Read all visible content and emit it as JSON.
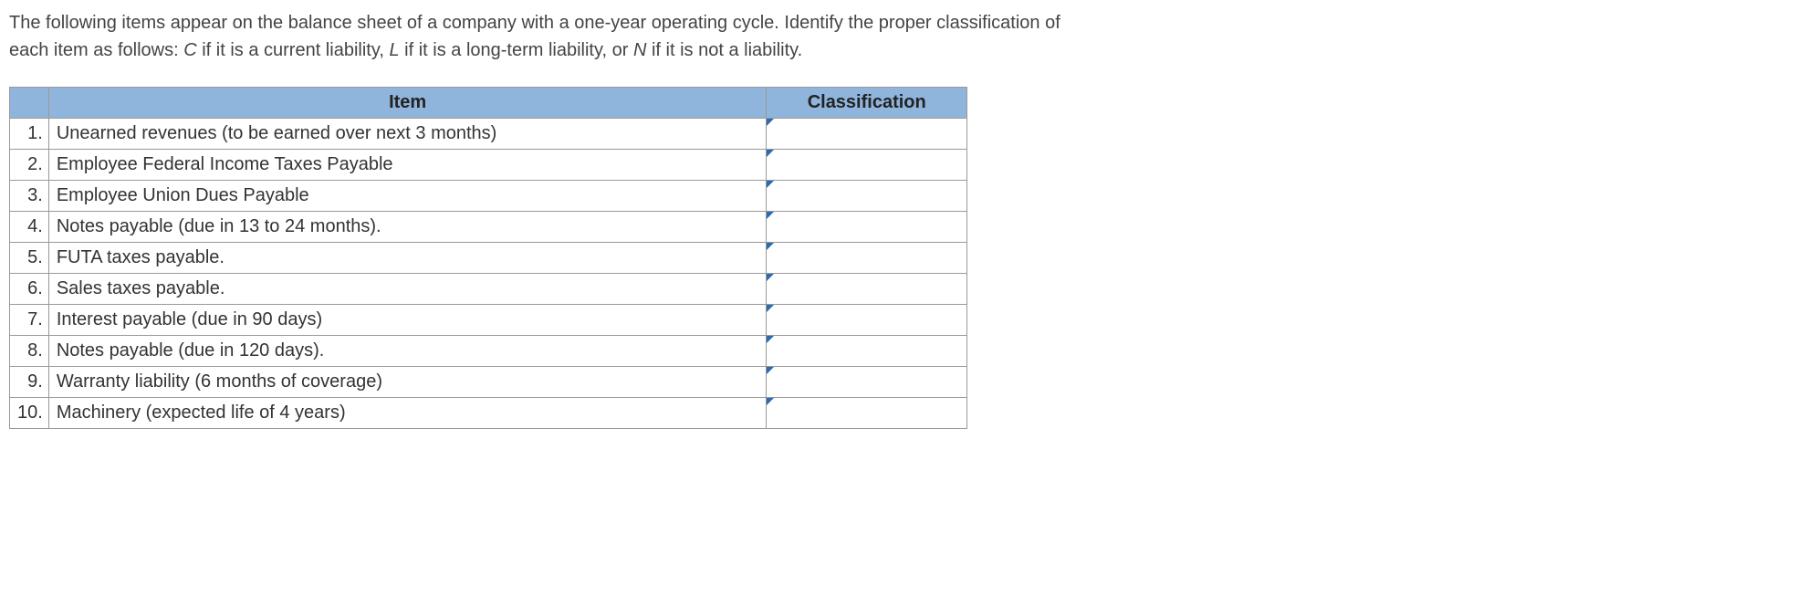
{
  "instructions": {
    "line1_pre": "The following items appear on the balance sheet of a company with a one-year operating cycle. Identify the proper classification of",
    "line2_pre": "each item as follows: ",
    "c_letter": "C",
    "c_suffix": " if it is a current liability, ",
    "l_letter": "L",
    "l_suffix": " if it is a long-term liability, or ",
    "n_letter": "N",
    "n_suffix": " if it is not a liability."
  },
  "headers": {
    "item": "Item",
    "classification": "Classification"
  },
  "rows": [
    {
      "num": "1.",
      "item": "Unearned revenues (to be earned over next 3 months)",
      "classification": ""
    },
    {
      "num": "2.",
      "item": "Employee Federal Income Taxes Payable",
      "classification": ""
    },
    {
      "num": "3.",
      "item": "Employee Union Dues Payable",
      "classification": ""
    },
    {
      "num": "4.",
      "item": "Notes payable (due in 13 to 24 months).",
      "classification": ""
    },
    {
      "num": "5.",
      "item": "FUTA taxes payable.",
      "classification": ""
    },
    {
      "num": "6.",
      "item": "Sales taxes payable.",
      "classification": ""
    },
    {
      "num": "7.",
      "item": "Interest payable (due in 90 days)",
      "classification": ""
    },
    {
      "num": "8.",
      "item": "Notes payable (due in 120 days).",
      "classification": ""
    },
    {
      "num": "9.",
      "item": "Warranty liability (6 months of coverage)",
      "classification": ""
    },
    {
      "num": "10.",
      "item": "Machinery (expected life of 4 years)",
      "classification": ""
    }
  ]
}
